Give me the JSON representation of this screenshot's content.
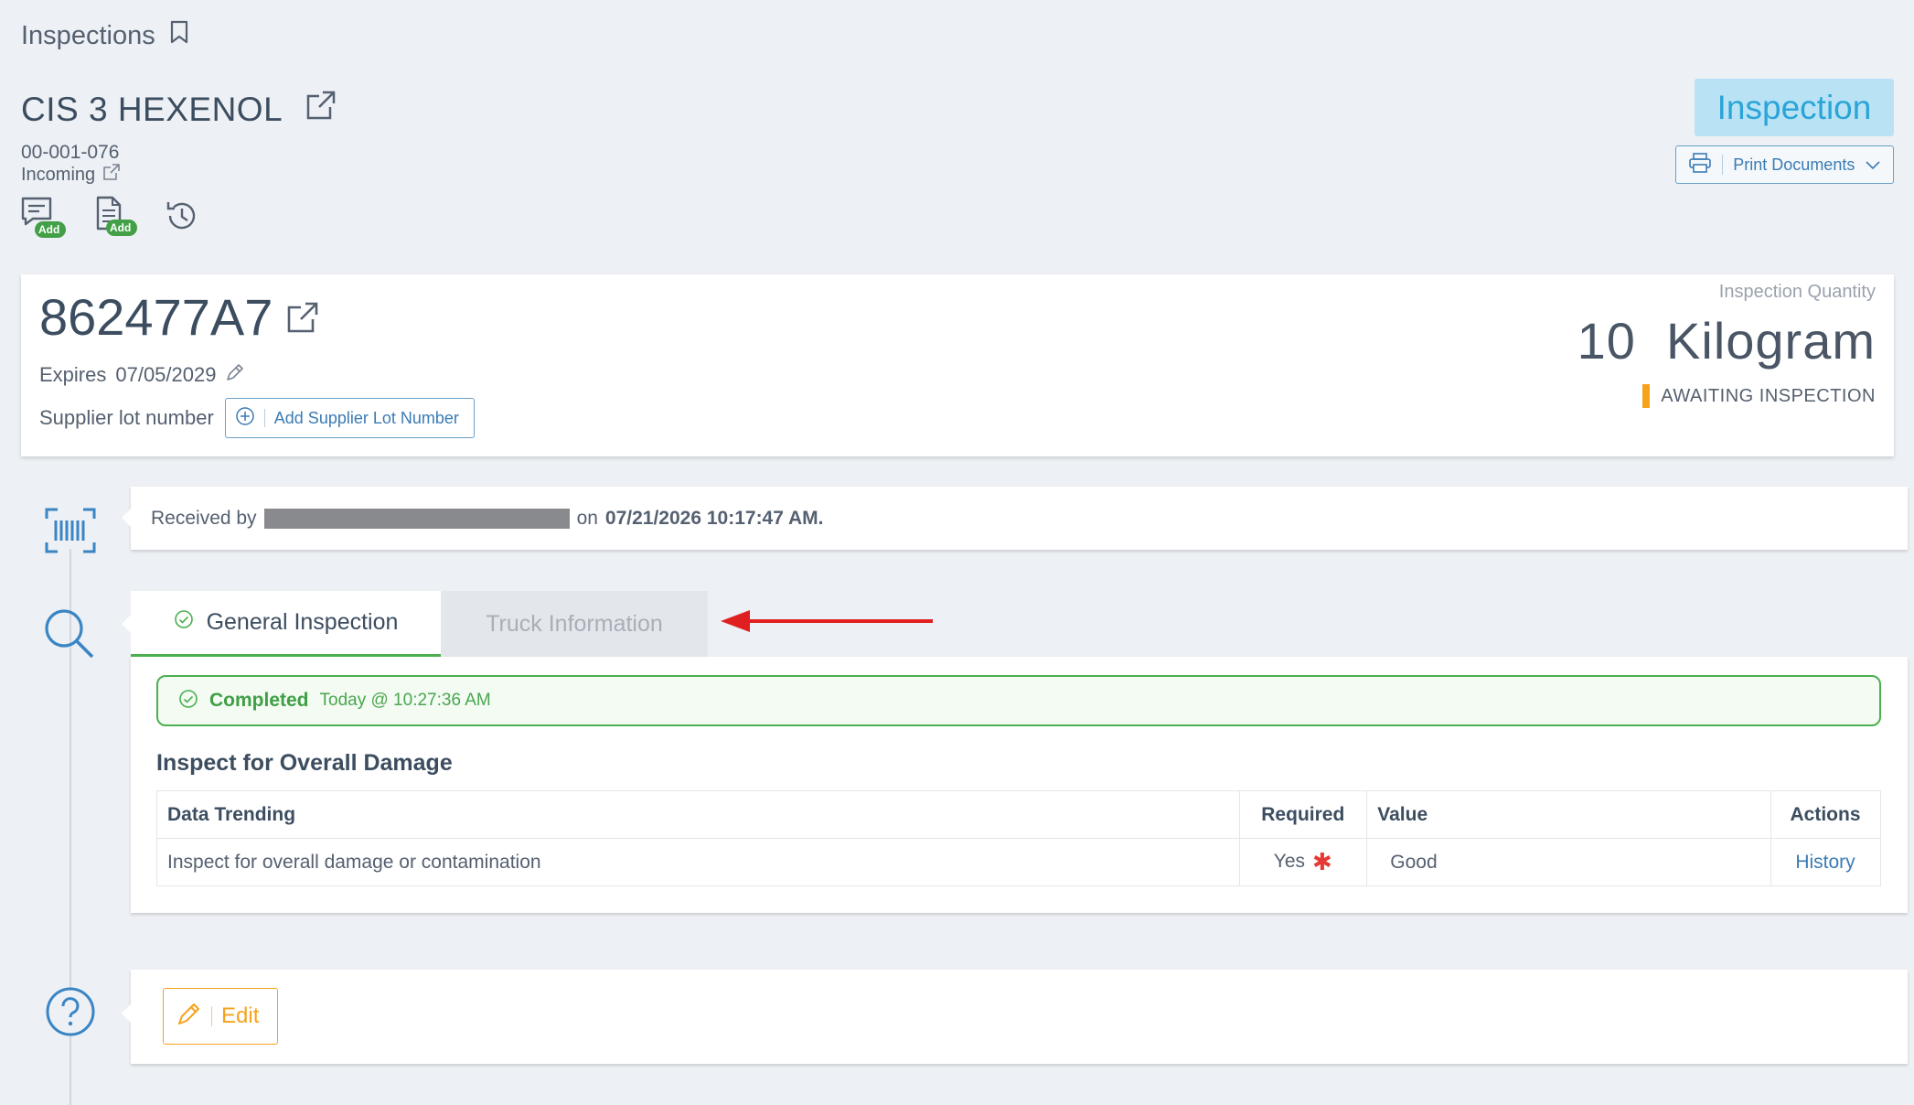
{
  "breadcrumb": {
    "label": "Inspections"
  },
  "header": {
    "title": "CIS 3 HEXENOL",
    "code": "00-001-076",
    "direction": "Incoming",
    "add_badge": "Add",
    "inspection_badge": "Inspection",
    "print_label": "Print Documents"
  },
  "lot": {
    "number": "862477A7",
    "expires_label": "Expires",
    "expires_value": "07/05/2029",
    "supplier_label": "Supplier lot number",
    "add_supplier_label": "Add Supplier Lot Number",
    "qty_label": "Inspection Quantity",
    "qty_value": "10  Kilogram",
    "status": "AWAITING INSPECTION"
  },
  "received": {
    "prefix": "Received by",
    "on": "on",
    "datetime": "07/21/2026 10:17:47 AM."
  },
  "tabs": [
    {
      "label": "General Inspection",
      "active": true
    },
    {
      "label": "Truck Information",
      "active": false
    }
  ],
  "inspection": {
    "completed_label": "Completed",
    "completed_time": "Today @ 10:27:36 AM",
    "section_title": "Inspect for Overall Damage",
    "columns": [
      "Data Trending",
      "Required",
      "Value",
      "Actions"
    ],
    "rows": [
      {
        "name": "Inspect for overall damage or contamination",
        "required": "Yes",
        "value": "Good",
        "action": "History"
      }
    ]
  },
  "edit": {
    "label": "Edit"
  },
  "colors": {
    "accent_blue": "#3a7bb5",
    "badge_bg": "#b9e3f5",
    "success": "#4caf50",
    "warning": "#f7a21b",
    "arrow": "#e02020"
  }
}
